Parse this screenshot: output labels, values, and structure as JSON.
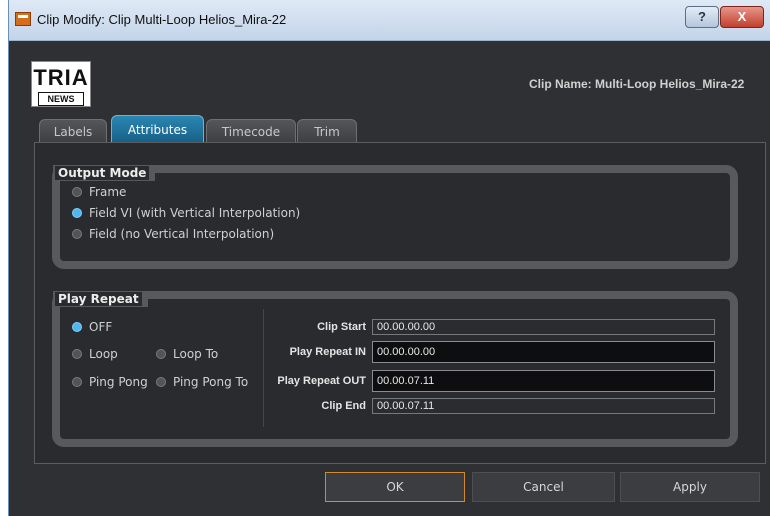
{
  "window": {
    "title": "Clip Modify: Clip Multi-Loop Helios_Mira-22",
    "help_label": "?",
    "close_label": "X"
  },
  "logo": {
    "line1": "TRIA",
    "line2": "NEWS"
  },
  "header": {
    "clip_name": "Clip Name: Multi-Loop Helios_Mira-22"
  },
  "tabs": [
    {
      "label": "Labels",
      "active": false
    },
    {
      "label": "Attributes",
      "active": true
    },
    {
      "label": "Timecode",
      "active": false
    },
    {
      "label": "Trim",
      "active": false
    }
  ],
  "output_mode": {
    "title": "Output Mode",
    "options": [
      {
        "label": "Frame",
        "selected": false
      },
      {
        "label": "Field VI (with Vertical Interpolation)",
        "selected": true
      },
      {
        "label": "Field (no Vertical Interpolation)",
        "selected": false
      }
    ]
  },
  "play_repeat": {
    "title": "Play Repeat",
    "options": [
      {
        "label": "OFF",
        "selected": true
      },
      {
        "label": "Loop",
        "selected": false
      },
      {
        "label": "Loop To",
        "selected": false
      },
      {
        "label": "Ping Pong",
        "selected": false
      },
      {
        "label": "Ping Pong To",
        "selected": false
      }
    ],
    "fields": {
      "clip_start": {
        "label": "Clip Start",
        "value": "00.00.00.00"
      },
      "play_repeat_in": {
        "label": "Play Repeat IN",
        "value": "00.00.00.00"
      },
      "play_repeat_out": {
        "label": "Play Repeat OUT",
        "value": "00.00.07.11"
      },
      "clip_end": {
        "label": "Clip End",
        "value": "00.00.07.11"
      }
    }
  },
  "buttons": {
    "ok": "OK",
    "cancel": "Cancel",
    "apply": "Apply"
  },
  "colors": {
    "active_tab": "#1f78a6",
    "radio_selected": "#4fb6ef",
    "ok_border": "#d38a2a",
    "close_button": "#c2402f"
  }
}
